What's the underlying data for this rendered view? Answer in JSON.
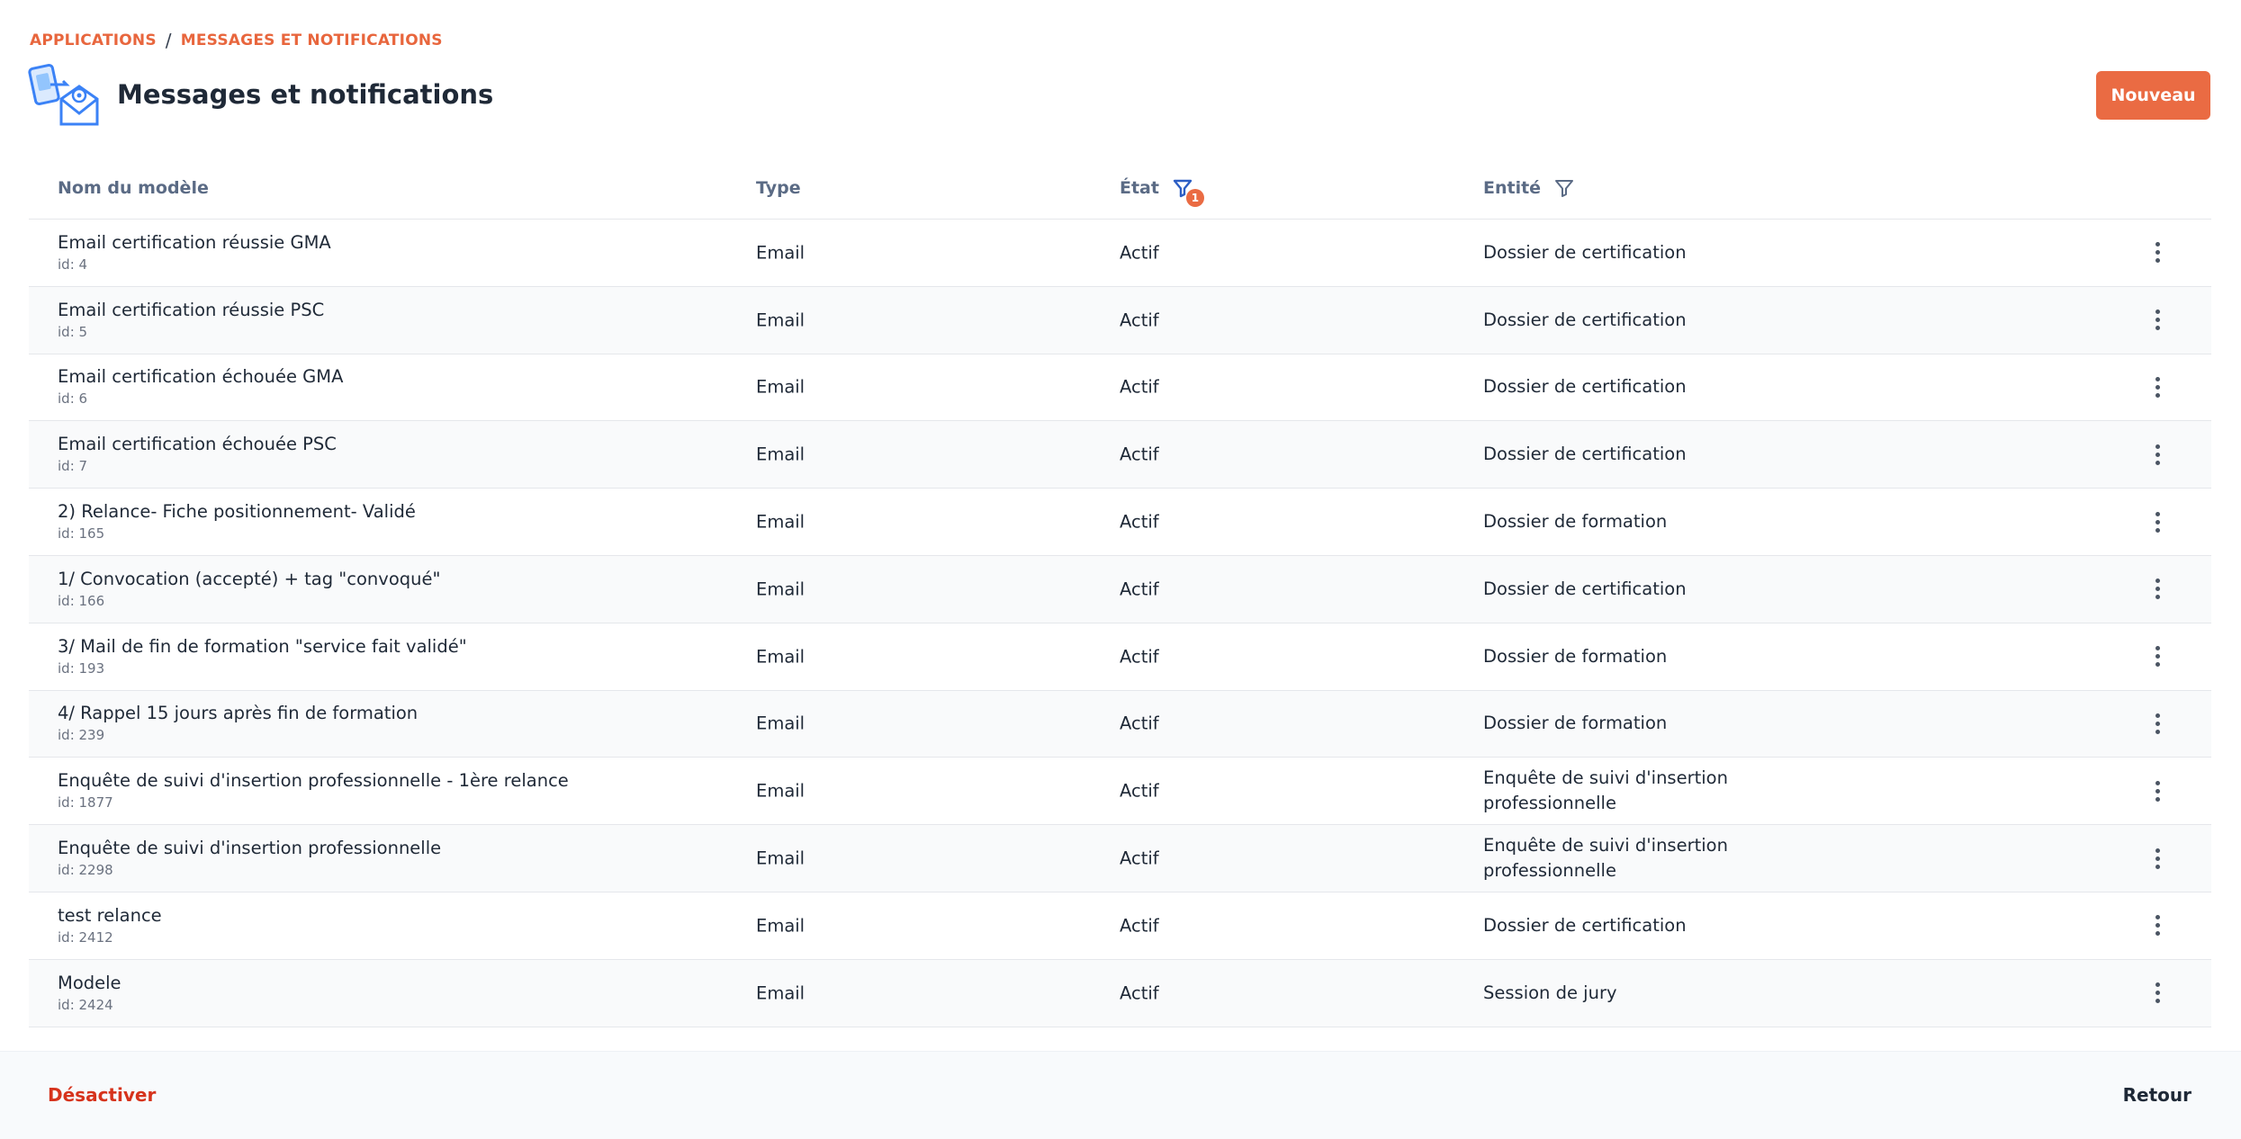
{
  "breadcrumb": {
    "root": "APPLICATIONS",
    "separator": "/",
    "current": "MESSAGES ET NOTIFICATIONS"
  },
  "page": {
    "title": "Messages et notifications",
    "icon": "messages-notifications-icon"
  },
  "toolbar": {
    "new_label": "Nouveau"
  },
  "colors": {
    "accent": "#ea6b43",
    "danger": "#d6331c",
    "filter_active": "#2c5ec4"
  },
  "table": {
    "headers": {
      "name": "Nom du modèle",
      "type": "Type",
      "state": "État",
      "entity": "Entité"
    },
    "state_filter_count": "1",
    "rows": [
      {
        "name": "Email certification réussie GMA",
        "id": "id: 4",
        "type": "Email",
        "state": "Actif",
        "entity": "Dossier de certification"
      },
      {
        "name": "Email certification réussie PSC",
        "id": "id: 5",
        "type": "Email",
        "state": "Actif",
        "entity": "Dossier de certification"
      },
      {
        "name": "Email certification échouée GMA",
        "id": "id: 6",
        "type": "Email",
        "state": "Actif",
        "entity": "Dossier de certification"
      },
      {
        "name": "Email certification échouée PSC",
        "id": "id: 7",
        "type": "Email",
        "state": "Actif",
        "entity": "Dossier de certification"
      },
      {
        "name": "2) Relance- Fiche positionnement- Validé",
        "id": "id: 165",
        "type": "Email",
        "state": "Actif",
        "entity": "Dossier de formation"
      },
      {
        "name": "1/ Convocation (accepté) + tag \"convoqué\"",
        "id": "id: 166",
        "type": "Email",
        "state": "Actif",
        "entity": "Dossier de certification"
      },
      {
        "name": "3/ Mail de fin de formation \"service fait validé\"",
        "id": "id: 193",
        "type": "Email",
        "state": "Actif",
        "entity": "Dossier de formation"
      },
      {
        "name": "4/ Rappel 15 jours après fin de formation",
        "id": "id: 239",
        "type": "Email",
        "state": "Actif",
        "entity": "Dossier de formation"
      },
      {
        "name": "Enquête de suivi d'insertion professionnelle - 1ère relance",
        "id": "id: 1877",
        "type": "Email",
        "state": "Actif",
        "entity": "Enquête de suivi d'insertion professionnelle"
      },
      {
        "name": "Enquête de suivi d'insertion professionnelle",
        "id": "id: 2298",
        "type": "Email",
        "state": "Actif",
        "entity": "Enquête de suivi d'insertion professionnelle"
      },
      {
        "name": "test relance",
        "id": "id: 2412",
        "type": "Email",
        "state": "Actif",
        "entity": "Dossier de certification"
      },
      {
        "name": "Modele",
        "id": "id: 2424",
        "type": "Email",
        "state": "Actif",
        "entity": "Session de jury"
      }
    ]
  },
  "footer": {
    "deactivate_label": "Désactiver",
    "back_label": "Retour"
  }
}
